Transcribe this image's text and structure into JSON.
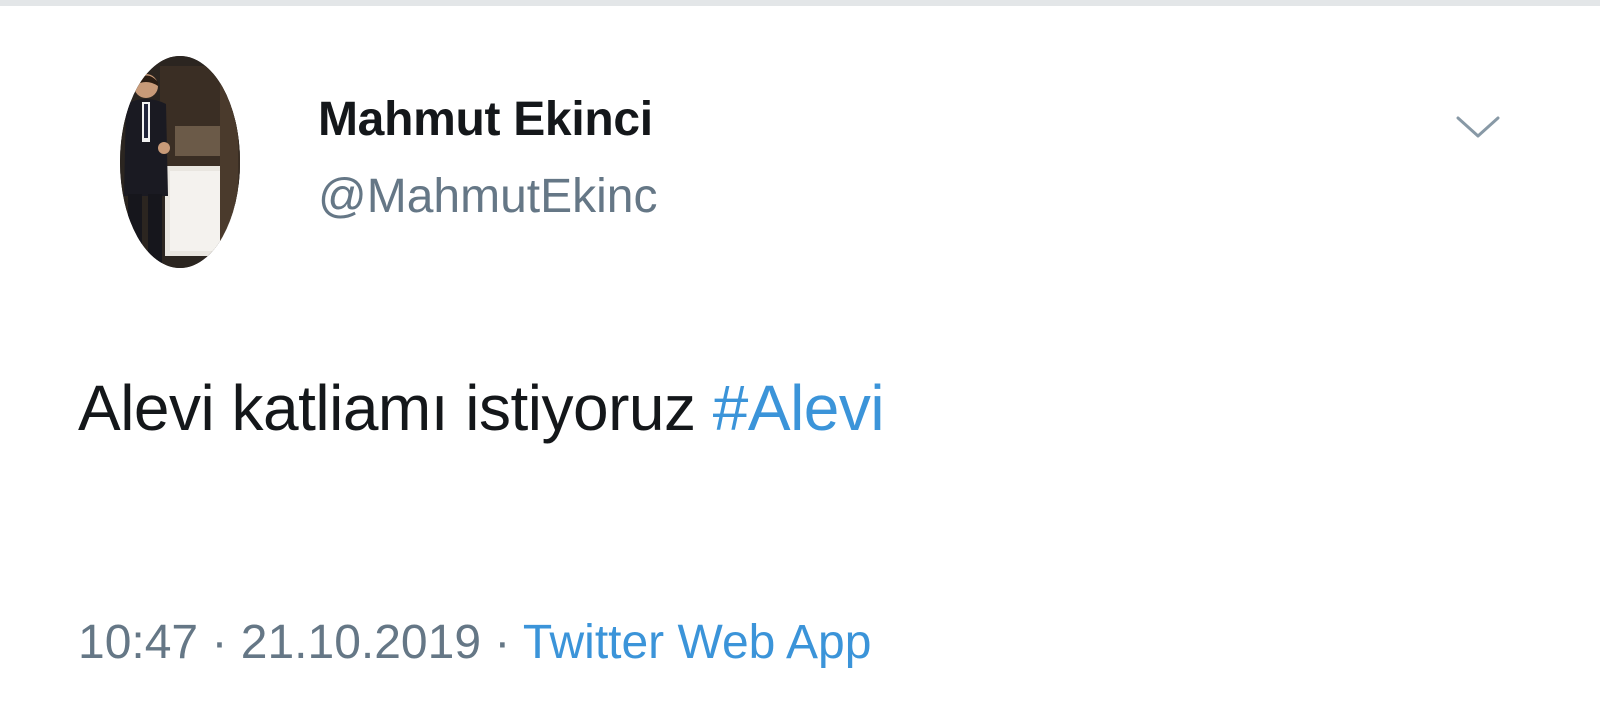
{
  "user": {
    "display_name": "Mahmut Ekinci",
    "handle": "@MahmutEkinc"
  },
  "tweet": {
    "text": "Alevi katliamı istiyoruz ",
    "hashtag": "#Alevi"
  },
  "meta": {
    "time": "10:47",
    "separator": " · ",
    "date": "21.10.2019",
    "source": "Twitter Web App"
  },
  "icons": {
    "menu": "chevron-down-icon",
    "avatar": "user-avatar-photo"
  },
  "colors": {
    "text": "#14171a",
    "secondary": "#657786",
    "link": "#3b94d9",
    "divider": "#e3e6e8"
  }
}
